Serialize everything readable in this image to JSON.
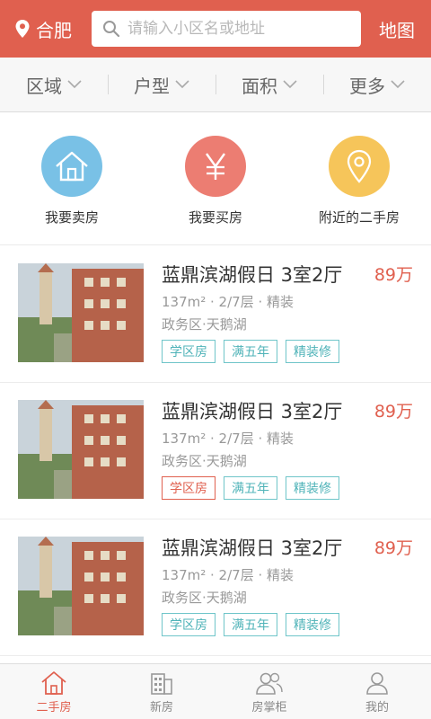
{
  "header": {
    "city": "合肥",
    "search_placeholder": "请输入小区名或地址",
    "map_label": "地图"
  },
  "filters": [
    {
      "label": "区域"
    },
    {
      "label": "户型"
    },
    {
      "label": "面积"
    },
    {
      "label": "更多"
    }
  ],
  "quick_actions": [
    {
      "label": "我要卖房",
      "icon": "house-icon",
      "color": "#79c1e6"
    },
    {
      "label": "我要买房",
      "icon": "yen-icon",
      "color": "#ec7d72"
    },
    {
      "label": "附近的二手房",
      "icon": "location-pin-icon",
      "color": "#f6c55a"
    }
  ],
  "listings": [
    {
      "title": "蓝鼎滨湖假日 3室2厅",
      "price": "89万",
      "meta": "137m² · 2/7层 · 精装",
      "location": "政务区·天鹅湖",
      "tags": [
        "学区房",
        "满五年",
        "精装修"
      ]
    },
    {
      "title": "蓝鼎滨湖假日 3室2厅",
      "price": "89万",
      "meta": "137m² · 2/7层 · 精装",
      "location": "政务区·天鹅湖",
      "tags": [
        "学区房",
        "满五年",
        "精装修"
      ]
    },
    {
      "title": "蓝鼎滨湖假日 3室2厅",
      "price": "89万",
      "meta": "137m² · 2/7层 · 精装",
      "location": "政务区·天鹅湖",
      "tags": [
        "学区房",
        "满五年",
        "精装修"
      ]
    }
  ],
  "tabbar": [
    {
      "label": "二手房",
      "icon": "house-icon",
      "active": true
    },
    {
      "label": "新房",
      "icon": "building-icon",
      "active": false
    },
    {
      "label": "房掌柜",
      "icon": "people-icon",
      "active": false
    },
    {
      "label": "我的",
      "icon": "user-icon",
      "active": false
    }
  ],
  "colors": {
    "brand": "#e0604f",
    "tag_teal": "#4fb3b8"
  }
}
